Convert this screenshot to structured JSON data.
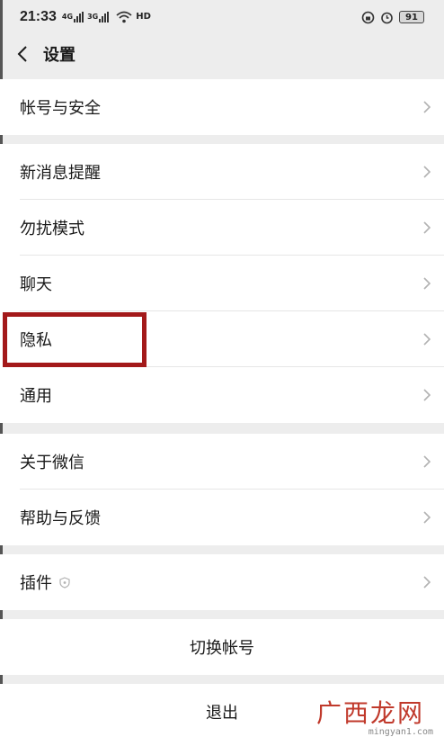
{
  "status_bar": {
    "time": "21:33",
    "signal_label_1": "4G",
    "signal_label_2": "3G",
    "network": "HD",
    "battery": "91"
  },
  "nav": {
    "title": "设置"
  },
  "groups": {
    "account": {
      "label": "帐号与安全"
    },
    "general": [
      {
        "label": "新消息提醒"
      },
      {
        "label": "勿扰模式"
      },
      {
        "label": "聊天"
      },
      {
        "label": "隐私"
      },
      {
        "label": "通用"
      }
    ],
    "about": [
      {
        "label": "关于微信"
      },
      {
        "label": "帮助与反馈"
      }
    ],
    "plugins": {
      "label": "插件"
    }
  },
  "actions": {
    "switch_account": "切换帐号",
    "logout": "退出"
  },
  "watermark": {
    "brand": "广西龙网",
    "url": "mingyan1.com"
  },
  "colors": {
    "highlight": "#a3191a",
    "background": "#ededed"
  }
}
